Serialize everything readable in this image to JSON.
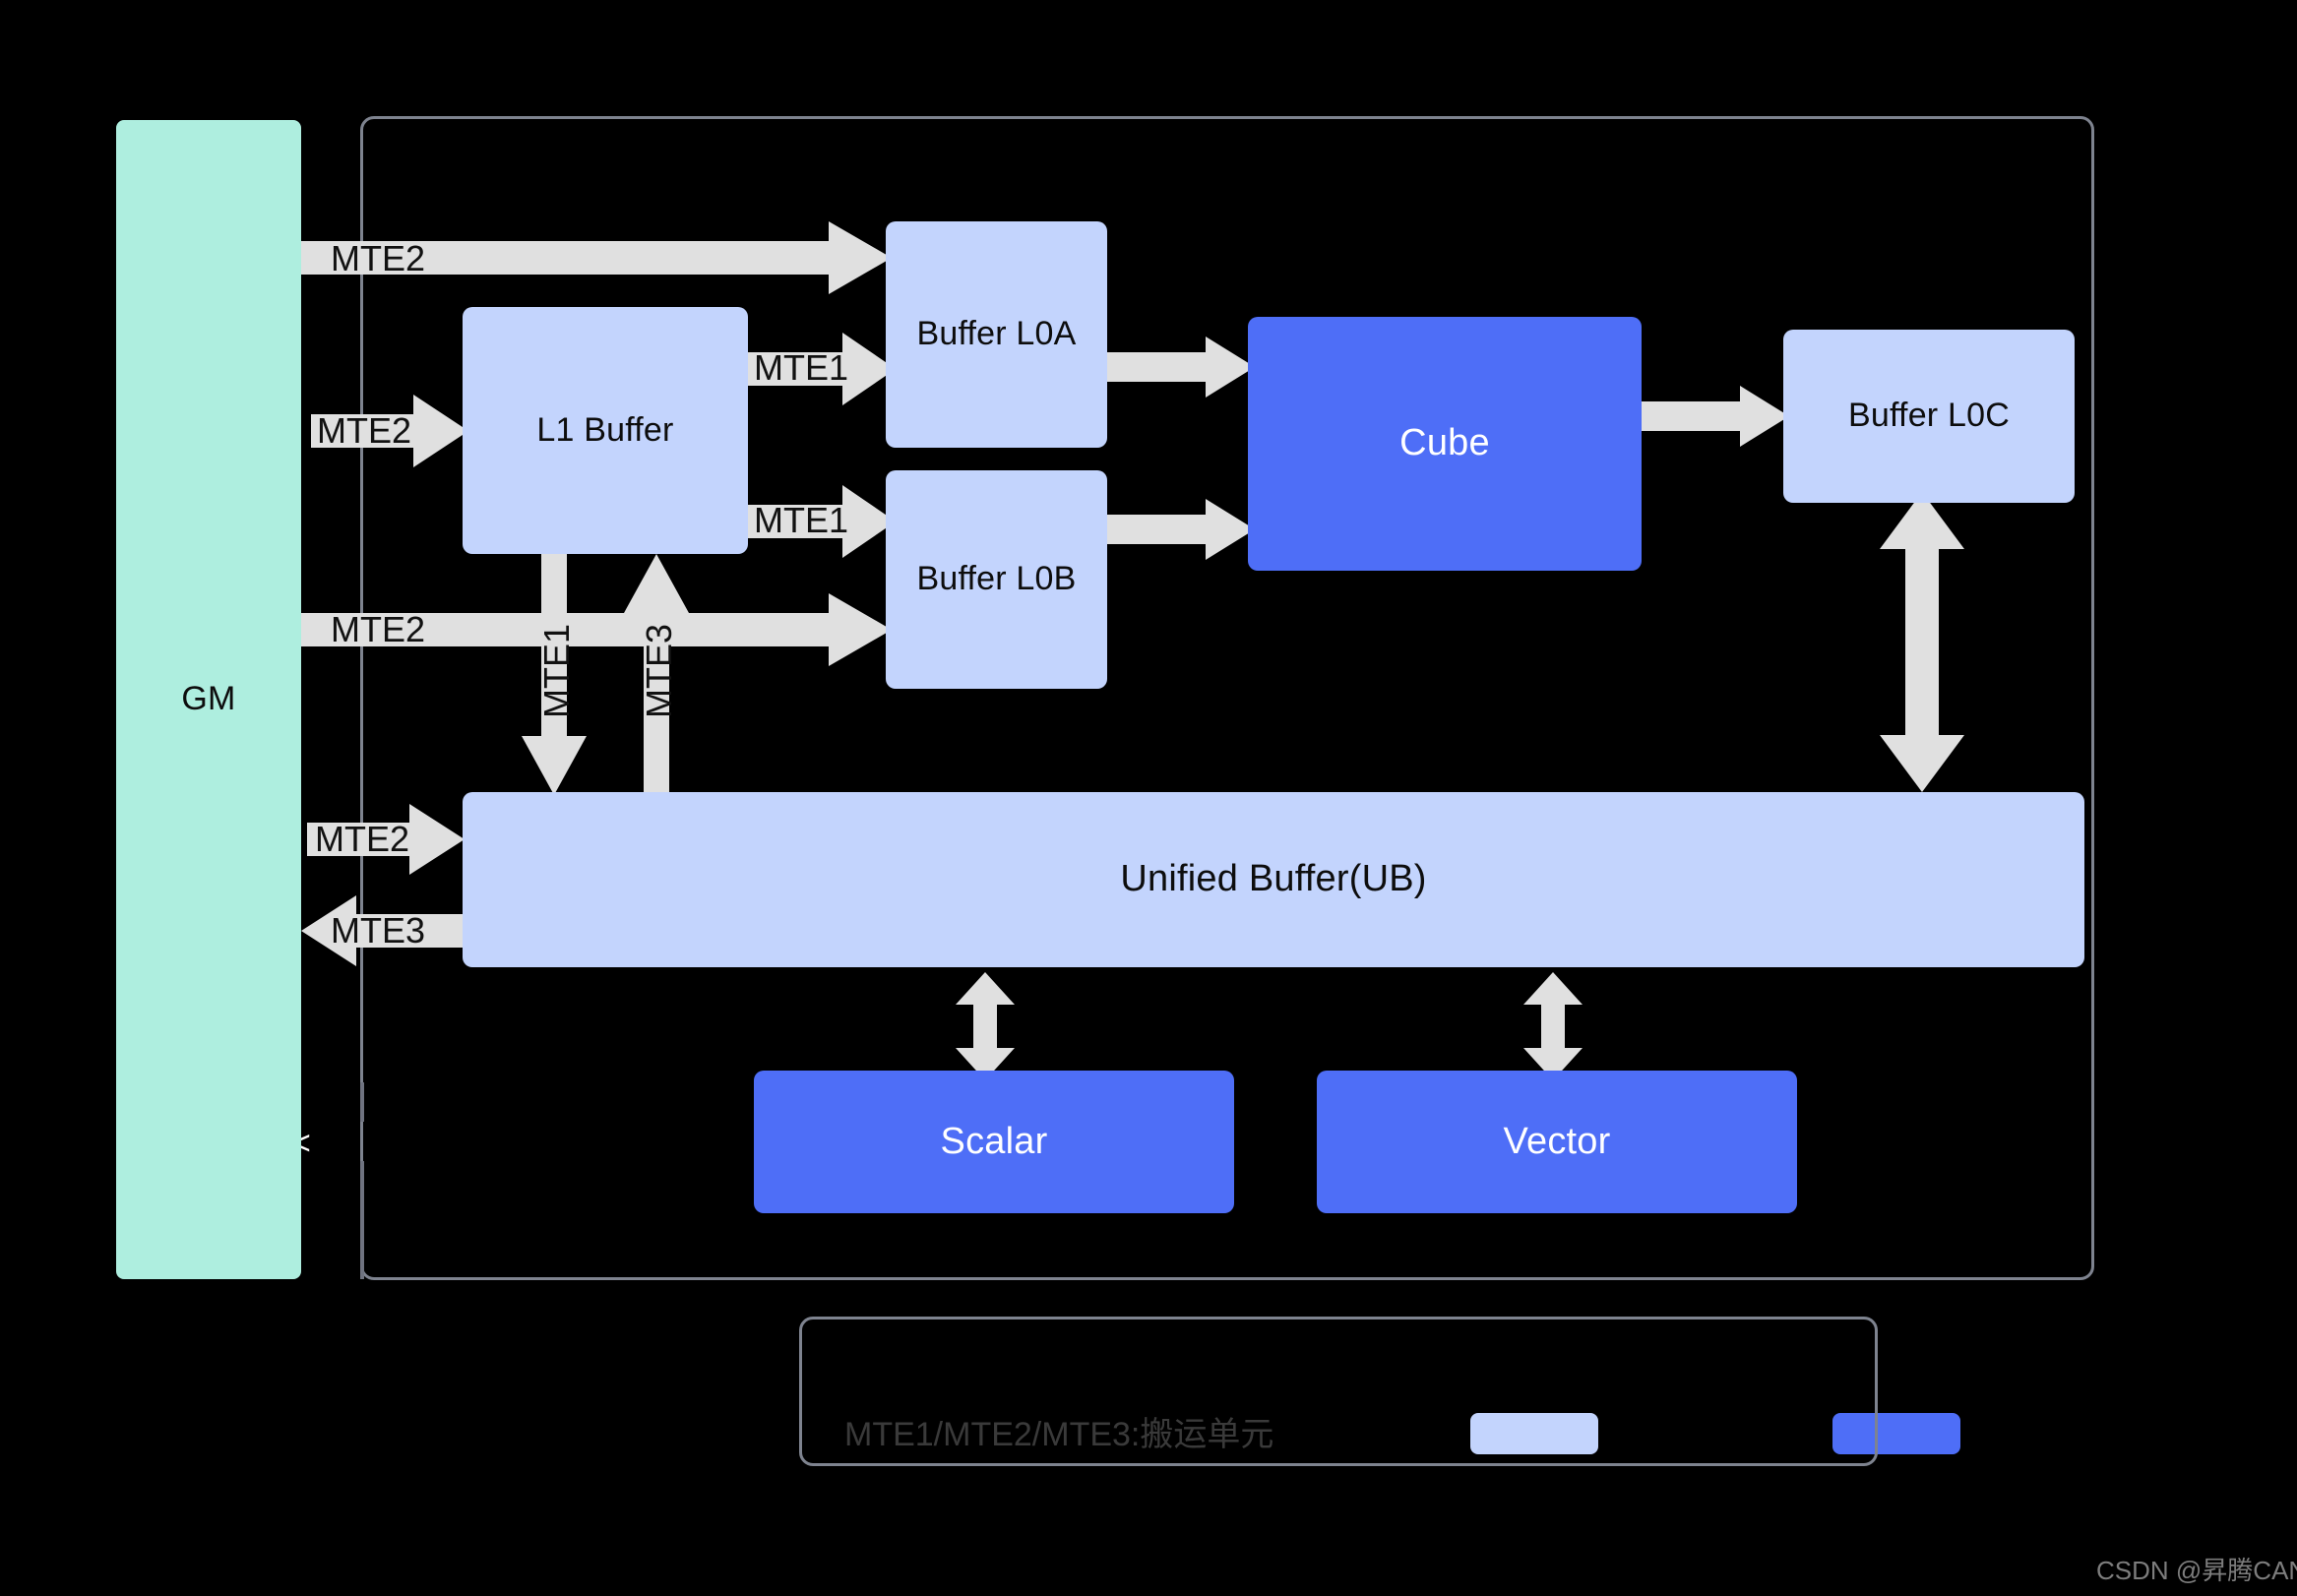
{
  "diagram": {
    "background": "#000000",
    "colors": {
      "gm_fill": "#AEEEDF",
      "buffer_fill": "#C3D4FD",
      "unit_fill": "#4E6EF7",
      "arrow_fill": "#E0E0E0",
      "container_border": "#7E838F",
      "label_text": "#111111",
      "legend_text": "#3a3a3a"
    },
    "blocks": {
      "gm": "GM",
      "l1_buffer": "L1 Buffer",
      "buffer_l0a": "Buffer L0A",
      "buffer_l0b": "Buffer L0B",
      "cube": "Cube",
      "buffer_l0c": "Buffer L0C",
      "unified_buffer": "Unified Buffer(UB)",
      "scalar": "Scalar",
      "vector": "Vector"
    },
    "arrow_labels": {
      "gm_to_l0a": "MTE2",
      "gm_to_l1": "MTE2",
      "gm_to_l0b": "MTE2",
      "gm_to_ub": "MTE2",
      "ub_to_gm": "MTE3",
      "l1_to_l0a": "MTE1",
      "l1_to_l0b": "MTE1",
      "l1_to_ub": "MTE1",
      "ub_to_l1": "MTE3"
    },
    "legend": {
      "note": "MTE1/MTE2/MTE3:搬运单元",
      "swatch_light": "#C3D4FD",
      "swatch_strong": "#4E6EF7"
    },
    "watermark": "CSDN @昇腾CANN"
  }
}
